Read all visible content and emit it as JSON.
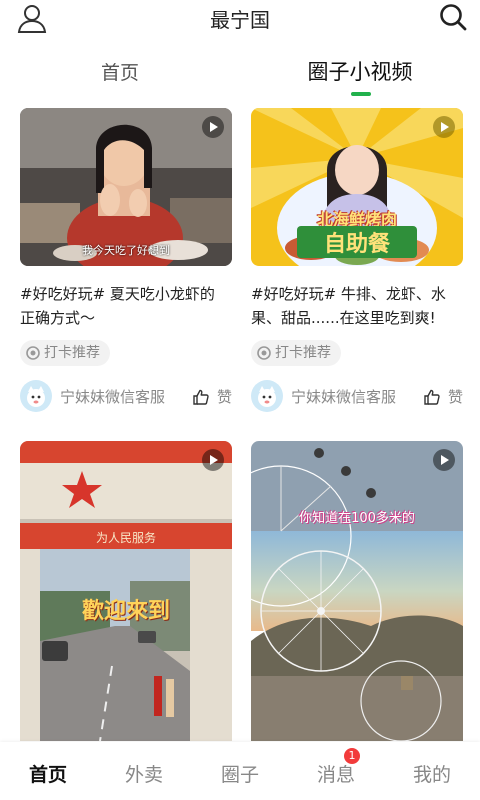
{
  "header": {
    "title": "最宁国",
    "user_icon": "user-icon",
    "search_icon": "search-icon"
  },
  "tabs": [
    {
      "label": "首页",
      "active": false
    },
    {
      "label": "圈子小视频",
      "active": true
    }
  ],
  "accent_color": "#22b14c",
  "cards": [
    {
      "title_line1": "#好吃好玩# 夏天吃小龙虾的",
      "title_line2": "正确方式～",
      "caption": "我今天吃了好想到",
      "tag": "打卡推荐",
      "author": "宁妹妹微信客服",
      "like_label": "赞"
    },
    {
      "title_line1": "#好吃好玩# 牛排、龙虾、水",
      "title_line2": "果、甜品......在这里吃到爽!",
      "caption_top": "北海鲜烤肉",
      "caption_bottom": "自助餐",
      "tag": "打卡推荐",
      "author": "宁妹妹微信客服",
      "like_label": "赞"
    },
    {
      "caption": "歡迎來到",
      "sign": "为人民服务"
    },
    {
      "caption": "你知道在100多米的"
    }
  ],
  "bottom_nav": [
    {
      "label": "首页",
      "active": true
    },
    {
      "label": "外卖",
      "active": false
    },
    {
      "label": "圈子",
      "active": false
    },
    {
      "label": "消息",
      "active": false,
      "badge": "1"
    },
    {
      "label": "我的",
      "active": false
    }
  ]
}
